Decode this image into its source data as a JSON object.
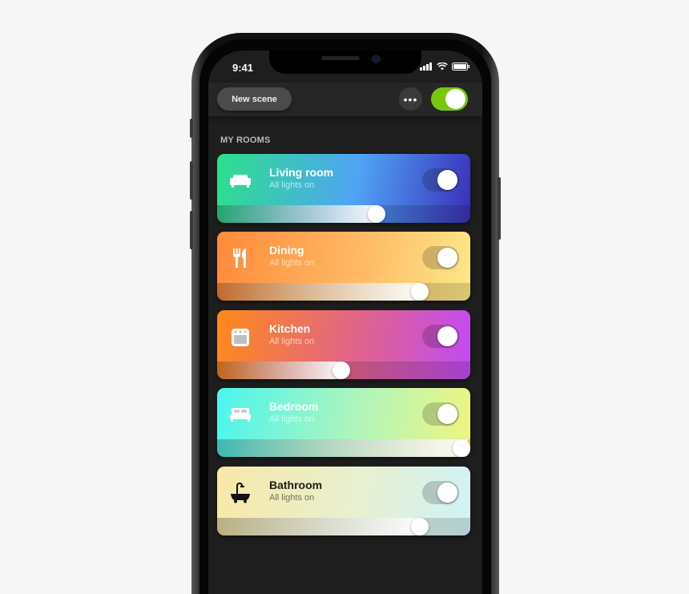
{
  "status_bar": {
    "time": "9:41",
    "icons": [
      "signal-icon",
      "wifi-icon",
      "battery-icon"
    ]
  },
  "header": {
    "new_scene_label": "New scene",
    "more_label": "•••",
    "master_toggle_on": true,
    "accent": "#76c80c"
  },
  "section_title": "MY ROOMS",
  "rooms": [
    {
      "name": "Living room",
      "status": "All lights on",
      "icon": "sofa-icon",
      "on": true,
      "brightness": 0.63,
      "gradient": [
        "#2de08a",
        "#4fa3f5",
        "#3a2fb8"
      ]
    },
    {
      "name": "Dining",
      "status": "All lights on",
      "icon": "fork-knife-icon",
      "on": true,
      "brightness": 0.8,
      "gradient": [
        "#ff8a3a",
        "#ffb864",
        "#fbe98a"
      ]
    },
    {
      "name": "Kitchen",
      "status": "All lights on",
      "icon": "oven-icon",
      "on": true,
      "brightness": 0.49,
      "gradient": [
        "#ff8a1a",
        "#e0648a",
        "#c04af5"
      ]
    },
    {
      "name": "Bedroom",
      "status": "All lights on",
      "icon": "bed-icon",
      "on": true,
      "brightness": 0.99,
      "gradient": [
        "#4af5ef",
        "#b0f5bb",
        "#f0f580"
      ]
    },
    {
      "name": "Bathroom",
      "status": "All lights on",
      "icon": "bathtub-icon",
      "on": true,
      "brightness": 0.8,
      "gradient": [
        "#f8e8a8",
        "#e8f0d0",
        "#d0f2f8"
      ]
    }
  ]
}
